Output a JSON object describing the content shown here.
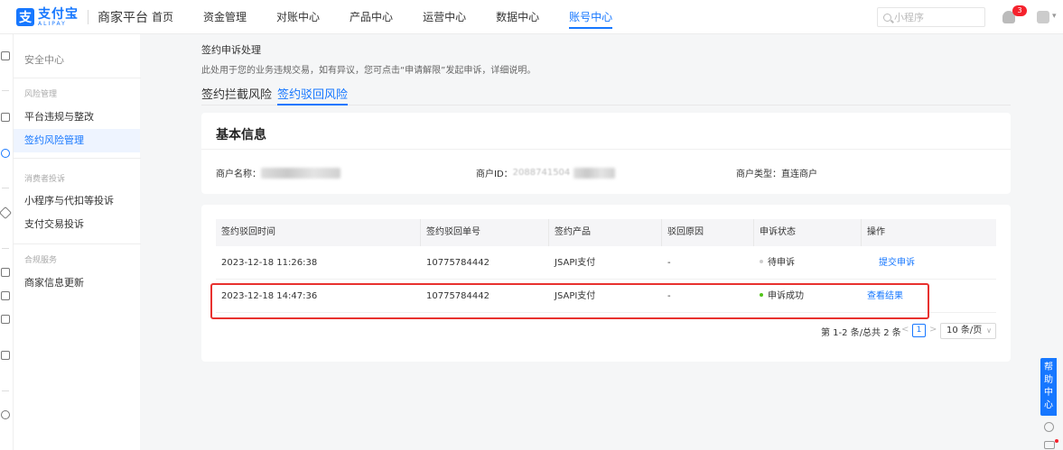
{
  "app": {
    "logo_mark": "支",
    "logo_cn": "支付宝",
    "logo_en": "ALIPAY",
    "platform": "商家平台"
  },
  "topnav": {
    "items": [
      {
        "label": "首页"
      },
      {
        "label": "资金管理"
      },
      {
        "label": "对账中心"
      },
      {
        "label": "产品中心"
      },
      {
        "label": "运营中心"
      },
      {
        "label": "数据中心"
      },
      {
        "label": "账号中心",
        "active": true
      }
    ],
    "search_placeholder": "小程序",
    "notification_count": "3"
  },
  "sidebar": {
    "top_item": "安全中心",
    "groups": [
      {
        "label": "风险管理",
        "items": [
          {
            "label": "平台违规与整改"
          },
          {
            "label": "签约风险管理",
            "active": true
          }
        ]
      },
      {
        "label": "消费者投诉",
        "items": [
          {
            "label": "小程序与代扣等投诉"
          },
          {
            "label": "支付交易投诉"
          }
        ]
      },
      {
        "label": "合规服务",
        "items": [
          {
            "label": "商家信息更新"
          }
        ]
      }
    ]
  },
  "page": {
    "title": "签约申诉处理",
    "description": "此处用于您的业务违规交易，如有异议，您可点击“申请解限”发起申诉，详细说明。",
    "tabs": [
      {
        "label": "签约拦截风险"
      },
      {
        "label": "签约驳回风险",
        "active": true
      }
    ]
  },
  "basic_info": {
    "title": "基本信息",
    "merchant_name_label": "商户名称：",
    "merchant_id_label": "商户ID：",
    "merchant_id_partial": "2088741504",
    "merchant_type_label": "商户类型：",
    "merchant_type_value": "直连商户"
  },
  "table": {
    "headers": [
      "签约驳回时间",
      "签约驳回单号",
      "签约产品",
      "驳回原因",
      "申诉状态",
      "操作"
    ],
    "rows": [
      {
        "time": "2023-12-18 11:26:38",
        "order_no": "10775784442",
        "product": "JSAPI支付",
        "reason": "-",
        "status": "待申诉",
        "status_color": "#cccccc",
        "action": "提交申诉"
      },
      {
        "time": "2023-12-18 14:47:36",
        "order_no": "10775784442",
        "product": "JSAPI支付",
        "reason": "-",
        "status": "申诉成功",
        "status_color": "#52c41a",
        "action": "查看结果"
      }
    ]
  },
  "pagination": {
    "total_text": "第 1-2 条/总共 2 条",
    "prev": "<",
    "current_page": "1",
    "next": ">",
    "page_size": "10 条/页"
  },
  "help": {
    "chars": [
      "帮",
      "助",
      "中",
      "心"
    ]
  },
  "colors": {
    "accent": "#1677ff",
    "highlight": "#e8312f",
    "success": "#52c41a"
  }
}
